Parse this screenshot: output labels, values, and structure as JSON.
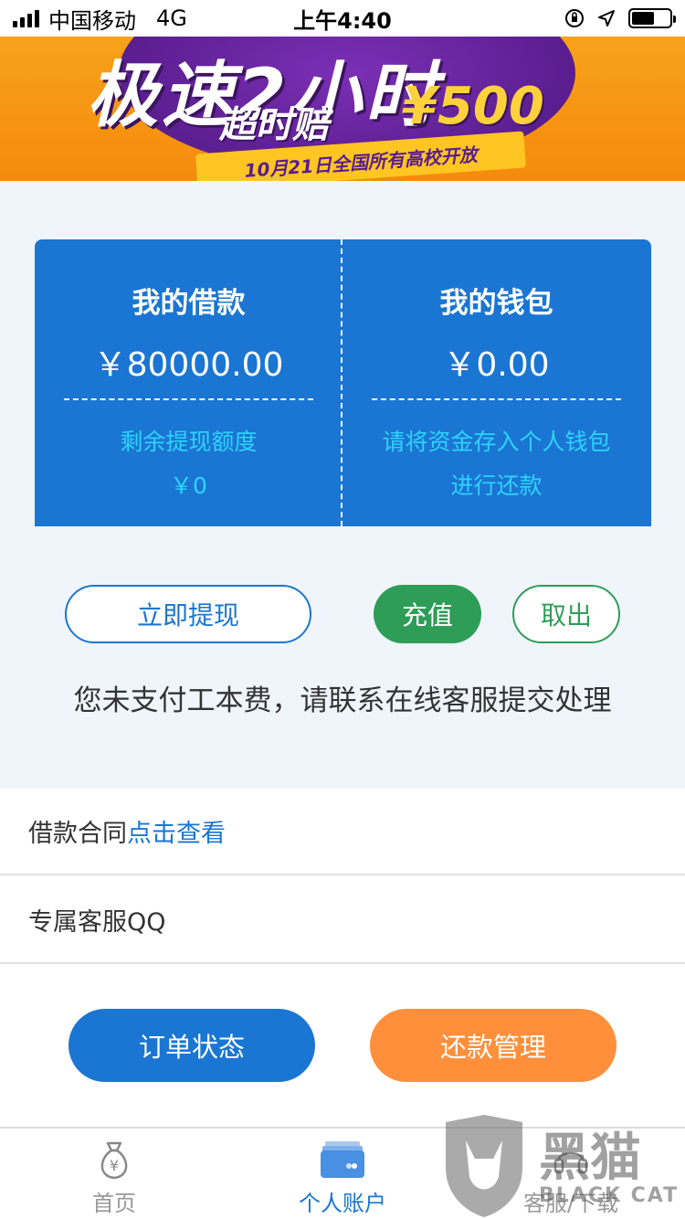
{
  "status_bar": {
    "carrier": "中国移动",
    "network": "4G",
    "time": "上午4:40"
  },
  "banner": {
    "headline": "极速2小时",
    "subline": "超时赔",
    "amount": "¥500",
    "ribbon": "10月21日全国所有高校开放"
  },
  "card": {
    "loan": {
      "title": "我的借款",
      "amount": "￥80000.00",
      "note_label": "剩余提现额度",
      "note_value": "￥0"
    },
    "wallet": {
      "title": "我的钱包",
      "amount": "￥0.00",
      "note_line1": "请将资金存入个人钱包",
      "note_line2": "进行还款"
    }
  },
  "actions": {
    "withdraw": "立即提现",
    "recharge": "充值",
    "takeout": "取出"
  },
  "notice": "您未支付工本费，请联系在线客服提交处理",
  "rows": {
    "contract_label": "借款合同",
    "contract_link": "点击查看",
    "qq_label": "专属客服QQ"
  },
  "bottom_buttons": {
    "order_status": "订单状态",
    "repay_manage": "还款管理"
  },
  "tabbar": {
    "home": "首页",
    "account": "个人账户",
    "service": "客服/下载"
  },
  "watermark": {
    "title": "黑猫",
    "subtitle": "BLACK CAT"
  },
  "colors": {
    "primary_blue": "#1a76d2",
    "accent_cyan": "#2fd3ff",
    "green": "#2e9d57",
    "orange": "#ff8f3a",
    "page_bg": "#eff5fb"
  },
  "icons": {
    "home": "money-bag-icon",
    "account": "wallet-icon",
    "service": "service-icon"
  }
}
